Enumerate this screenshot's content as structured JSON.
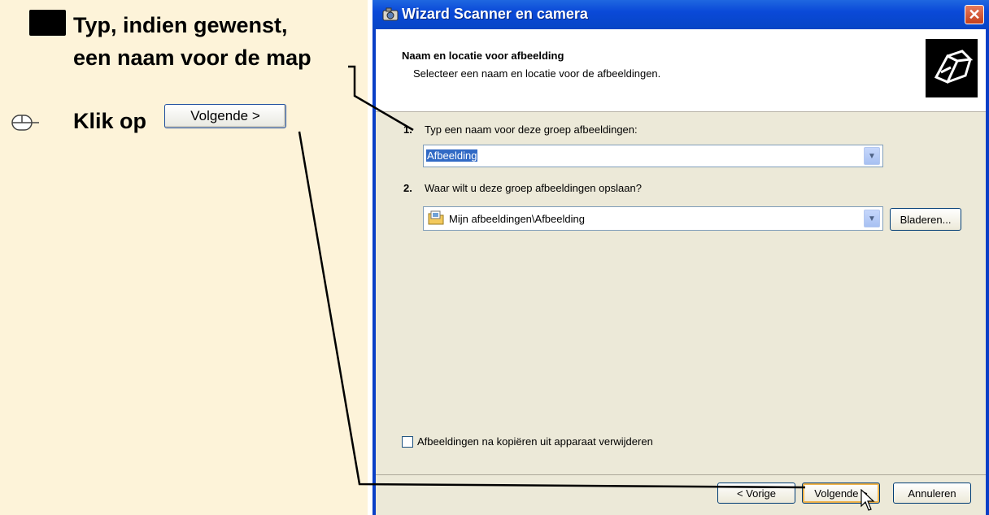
{
  "instructions": {
    "line1": "Typ, indien gewenst,",
    "line2": "een naam voor de map",
    "click_prefix": "Klik op",
    "reference_button": "Volgende >"
  },
  "window": {
    "title": "Wizard Scanner en camera",
    "close_label": "✕"
  },
  "header": {
    "title": "Naam en locatie voor afbeelding",
    "subtitle": "Selecteer een naam en locatie voor de afbeeldingen."
  },
  "step1": {
    "number": "1.",
    "text": "Typ een naam voor deze groep afbeeldingen:",
    "value": "Afbeelding"
  },
  "step2": {
    "number": "2.",
    "text": "Waar wilt u deze groep afbeeldingen opslaan?",
    "value": "Mijn afbeeldingen\\Afbeelding",
    "browse_label": "Bladeren..."
  },
  "checkbox": {
    "label": "Afbeeldingen na kopiëren uit apparaat verwijderen",
    "checked": false
  },
  "buttons": {
    "back": "< Vorige",
    "next": "Volgende >",
    "cancel": "Annuleren"
  },
  "icons": {
    "keyboard": "keyboard-icon",
    "mouse": "mouse-icon",
    "camera": "camera-icon",
    "folder": "folder-icon",
    "wizard_logo": "scanner-camera-logo-icon",
    "cursor": "cursor-icon"
  },
  "colors": {
    "title_bar": "#0a49d8",
    "instruction_panel": "#fdf3d9",
    "dialog_body": "#ece9d8",
    "selection": "#316ac5"
  }
}
